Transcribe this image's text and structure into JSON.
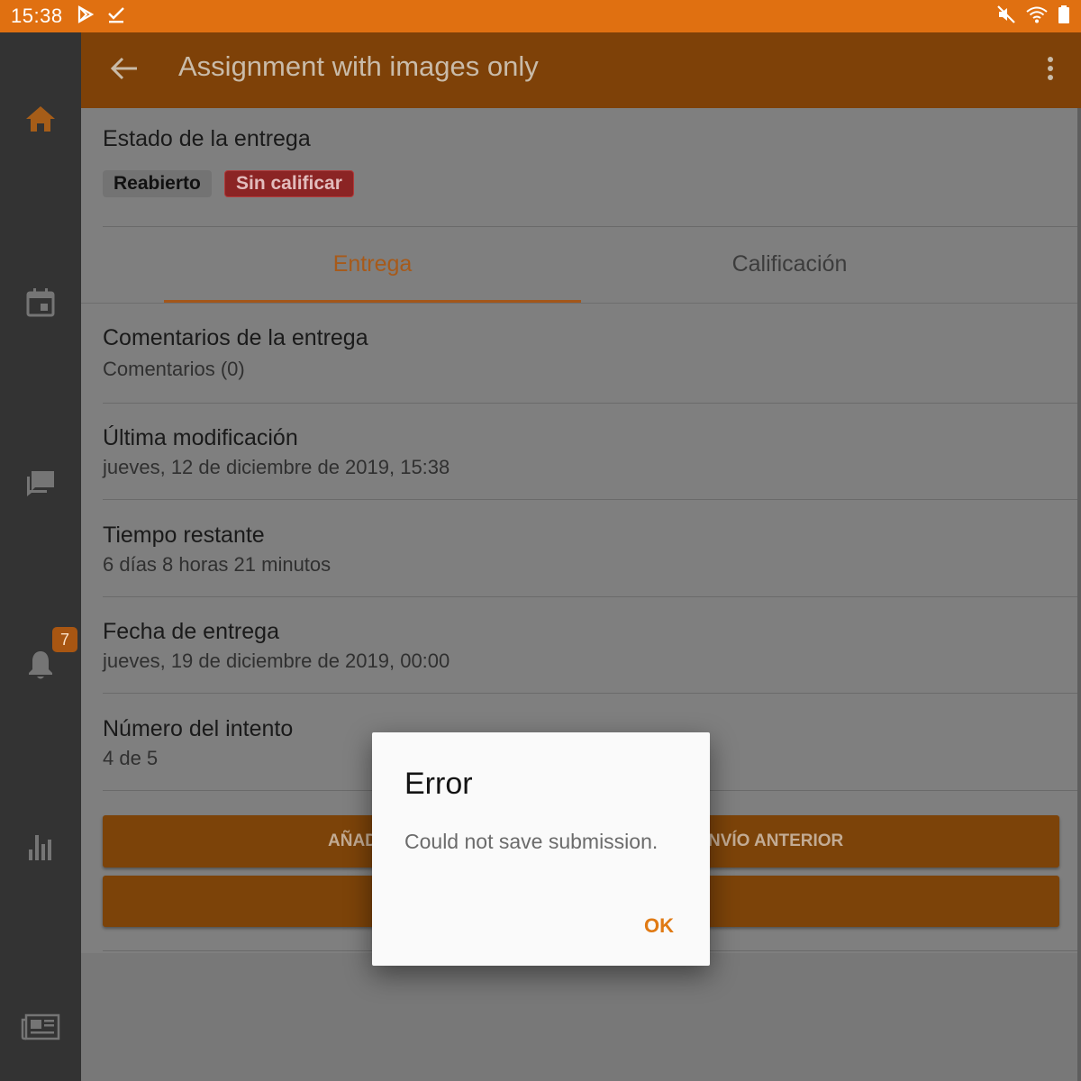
{
  "status_bar": {
    "time": "15:38"
  },
  "sidebar": {
    "notifications_count": "7"
  },
  "app_bar": {
    "title": "Assignment with images only"
  },
  "submission_status": {
    "title": "Estado de la entrega",
    "badge_reopened": "Reabierto",
    "badge_ungraded": "Sin calificar"
  },
  "tabs": [
    {
      "label": "Entrega"
    },
    {
      "label": "Calificación"
    }
  ],
  "items": [
    {
      "title": "Comentarios de la entrega",
      "subtitle": "Comentarios (0)"
    },
    {
      "title": "Última modificación",
      "subtitle": "jueves, 12 de diciembre de 2019, 15:38"
    },
    {
      "title": "Tiempo restante",
      "subtitle": "6 días 8 horas 21 minutos"
    },
    {
      "title": "Fecha de entrega",
      "subtitle": "jueves, 19 de diciembre de 2019, 00:00"
    },
    {
      "title": "Número del intento",
      "subtitle": "4 de 5"
    }
  ],
  "buttons": {
    "left_visible": "AÑAD",
    "right_visible": "NVÍO ANTERIOR"
  },
  "dialog": {
    "title": "Error",
    "message": "Could not save submission.",
    "ok_label": "OK"
  },
  "colors": {
    "accent": "#e07011",
    "app_bar_dimmed": "#7e4108",
    "ungraded": "#8b2424"
  }
}
